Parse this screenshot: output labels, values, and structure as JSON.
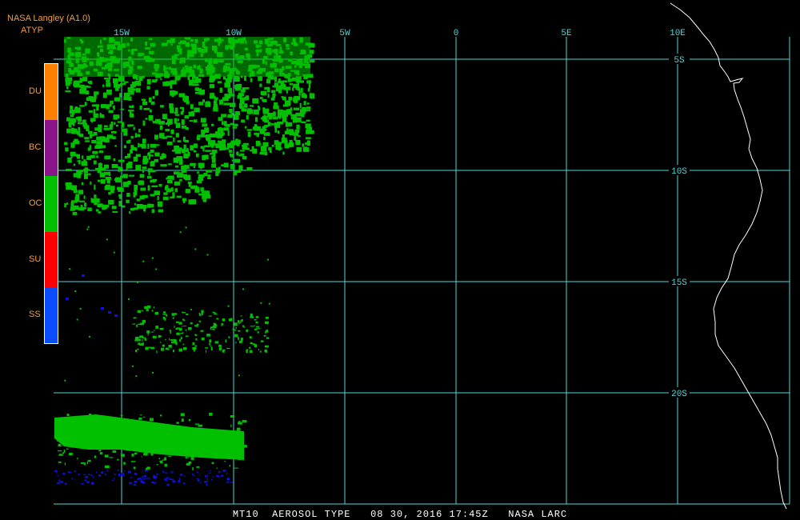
{
  "header": {
    "source": "NASA Langley (A1.0)",
    "product": "ATYP"
  },
  "legend": [
    {
      "code": "DU",
      "color": "#ff8000"
    },
    {
      "code": "BC",
      "color": "#8a148a"
    },
    {
      "code": "OC",
      "color": "#00c000"
    },
    {
      "code": "SU",
      "color": "#ff0000"
    },
    {
      "code": "SS",
      "color": "#0a4cff"
    }
  ],
  "longitude_labels": [
    "15W",
    "10W",
    "5W",
    "0",
    "5E",
    "10E"
  ],
  "latitude_labels": [
    "5S",
    "10S",
    "15S",
    "20S"
  ],
  "footer": {
    "text": "MT10  AEROSOL TYPE   08 30, 2016 17:45Z   NASA LARC"
  },
  "colors": {
    "grid": "#52d6d6",
    "coast": "#ffffff",
    "oc": "#00c000",
    "ss": "#1010e0"
  }
}
